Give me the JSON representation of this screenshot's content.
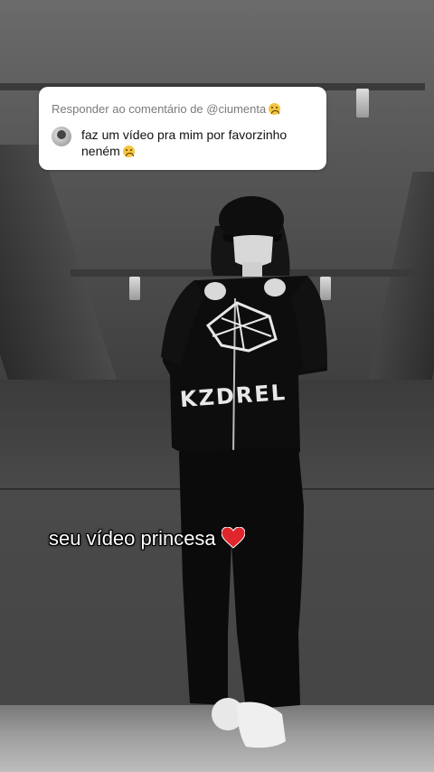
{
  "reply": {
    "title": "Responder ao comentário de @ciumenta",
    "comment": "faz um vídeo pra mim por favorzinho neném"
  },
  "caption": {
    "text": "seu vídeo princesa",
    "icon": "red-heart-icon"
  },
  "graphic_text": {
    "hoodie_print": "KZDREL"
  },
  "colors": {
    "card_bg": "#ffffff",
    "title_text": "#7a7a7a",
    "heart": "#e0262d"
  }
}
